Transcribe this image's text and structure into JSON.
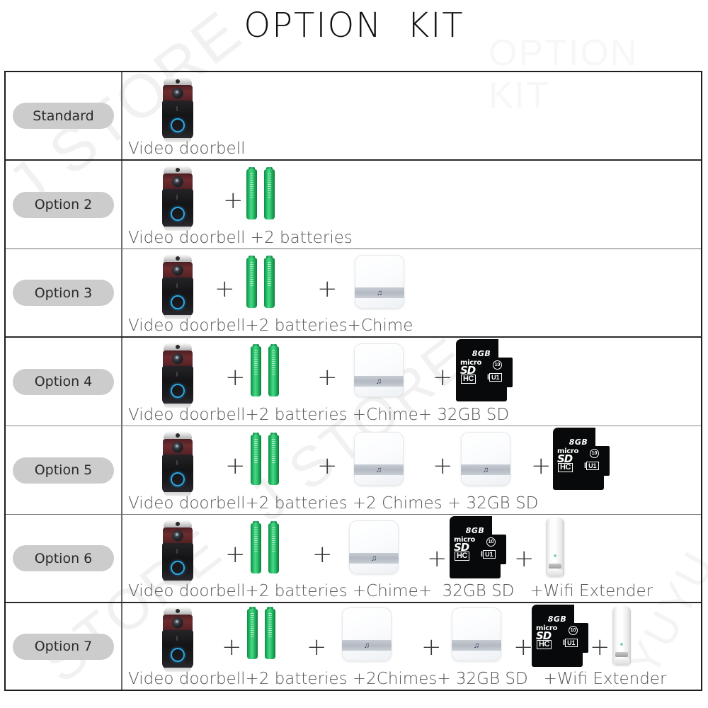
{
  "title": "OPTION  KIT",
  "watermarks": [
    "J STORE",
    "J STORE",
    "OPTION KIT",
    "STORE",
    "YUYU"
  ],
  "icons": {
    "music_note": "♫",
    "sd_8gb": "8GB",
    "sd_micro": "micro",
    "sd_sd": "SD",
    "sd_class": "10",
    "sd_hc": "HC",
    "sd_u": "I",
    "sd_u1": "U1"
  },
  "plus": "+",
  "rows": [
    {
      "label": "Standard",
      "caption": "Video doorbell",
      "items": [
        "doorbell"
      ]
    },
    {
      "label": "Option 2",
      "caption": "Video doorbell +2 batteries",
      "items": [
        "doorbell",
        "plus",
        "batteries"
      ]
    },
    {
      "label": "Option 3",
      "caption": "Video doorbell+2 batteries+Chime",
      "items": [
        "doorbell",
        "plus",
        "batteries",
        "plus",
        "chime"
      ]
    },
    {
      "label": "Option 4",
      "caption": "Video doorbell+2 batteries +Chime+ 32GB SD",
      "items": [
        "doorbell",
        "plus",
        "batteries",
        "plus",
        "chime",
        "plus",
        "sd"
      ]
    },
    {
      "label": "Option 5",
      "caption": "Video doorbell+2 batteries +2 Chimes + 32GB SD",
      "items": [
        "doorbell",
        "plus",
        "batteries",
        "plus",
        "chime",
        "plus",
        "chime",
        "plus",
        "sd"
      ]
    },
    {
      "label": "Option 6",
      "caption": "Video doorbell+2 batteries +Chime+  32GB SD   +Wifi Extender",
      "items": [
        "doorbell",
        "plus",
        "batteries",
        "plus",
        "chime",
        "plus",
        "sd",
        "plus",
        "wifi"
      ]
    },
    {
      "label": "Option 7",
      "caption": "Video doorbell+2 batteries +2Chimes+ 32GB SD   +Wifi Extender",
      "items": [
        "doorbell",
        "plus",
        "batteries",
        "plus",
        "chime",
        "plus",
        "chime",
        "plus",
        "sd",
        "plus",
        "wifi"
      ]
    }
  ],
  "colors": {
    "pill_bg": "#cccccc",
    "battery_green": "#23b862",
    "doorbell_ring": "#2aa8e8",
    "sd_black": "#08090a",
    "border": "#1c1c1c"
  }
}
